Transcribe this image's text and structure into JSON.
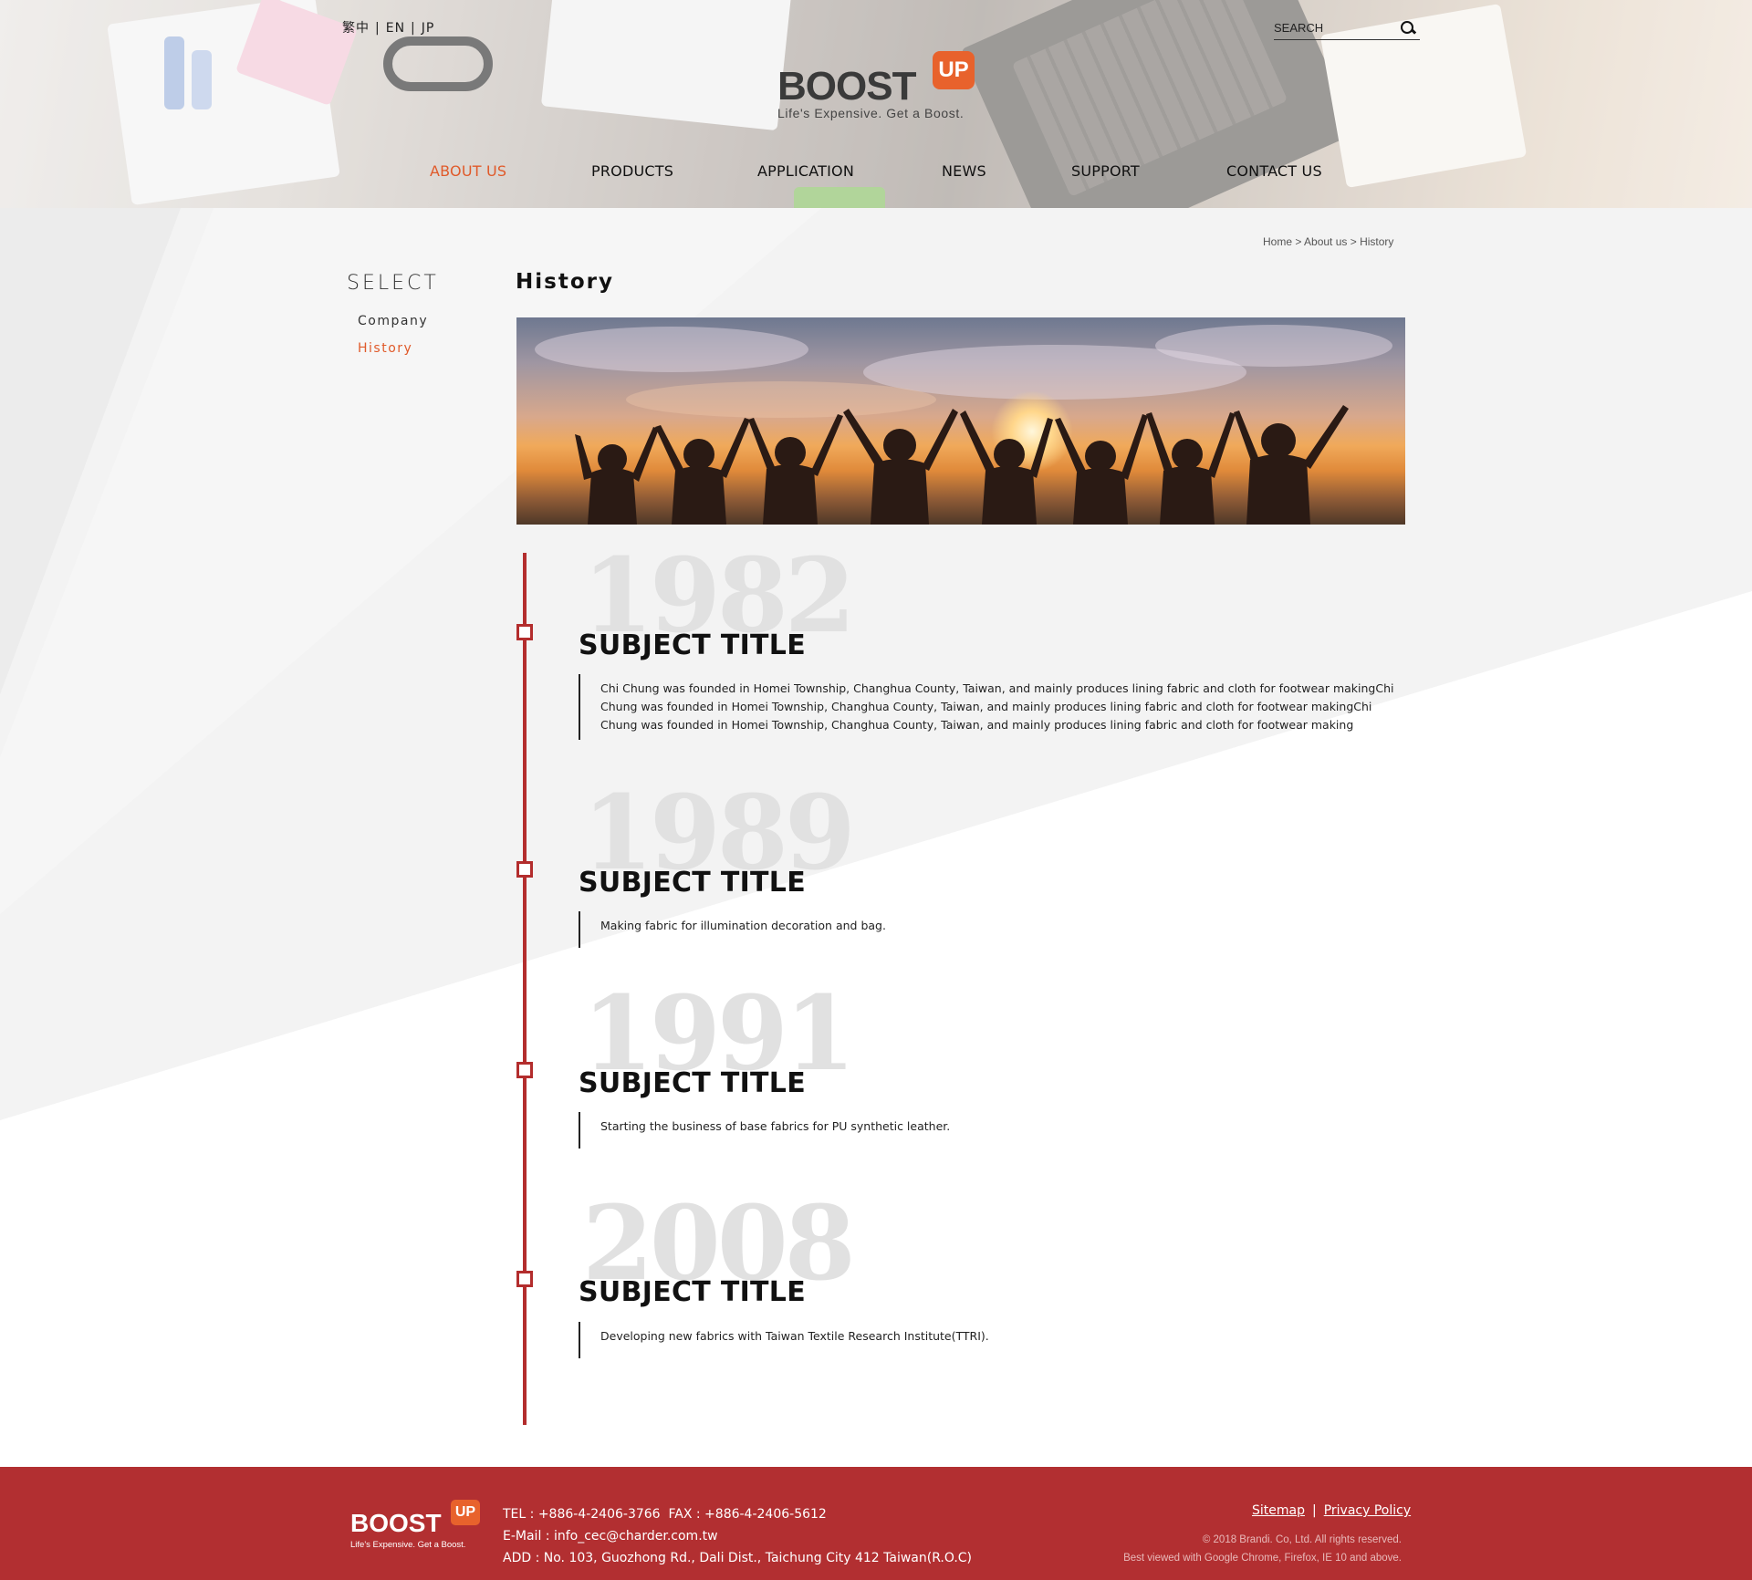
{
  "header": {
    "languages": [
      "繁中",
      "EN",
      "JP"
    ],
    "search_placeholder": "SEARCH",
    "logo": {
      "word": "BOOST",
      "badge": "UP",
      "tagline": "Life's Expensive. Get a Boost."
    },
    "nav": [
      {
        "label": "ABOUT US",
        "active": true
      },
      {
        "label": "PRODUCTS",
        "active": false
      },
      {
        "label": "APPLICATION",
        "active": false
      },
      {
        "label": "NEWS",
        "active": false
      },
      {
        "label": "SUPPORT",
        "active": false
      },
      {
        "label": "CONTACT US",
        "active": false
      }
    ],
    "accent_color": "#e05a2a"
  },
  "breadcrumb": "Home > About us > History",
  "sidebar": {
    "title": "SELECT",
    "items": [
      {
        "label": "Company",
        "active": false
      },
      {
        "label": "History",
        "active": true
      }
    ]
  },
  "main": {
    "title": "History",
    "timeline": [
      {
        "year": "1982",
        "title": "SUBJECT TITLE",
        "description": "Chi Chung was founded in Homei Township, Changhua County, Taiwan, and mainly produces lining fabric and cloth for footwear makingChi Chung was founded in Homei Township, Changhua County, Taiwan, and mainly produces lining fabric and cloth for footwear makingChi Chung was founded in Homei Township, Changhua County, Taiwan, and mainly produces lining fabric and cloth for footwear making"
      },
      {
        "year": "1989",
        "title": "SUBJECT TITLE",
        "description": "Making fabric for illumination decoration and bag."
      },
      {
        "year": "1991",
        "title": "SUBJECT TITLE",
        "description": "Starting the business of base fabrics for PU synthetic leather."
      },
      {
        "year": "2008",
        "title": "SUBJECT TITLE",
        "description": "Developing new fabrics with Taiwan Textile Research Institute(TTRI)."
      }
    ],
    "timeline_color": "#b32d2d"
  },
  "footer": {
    "logo": {
      "word": "BOOST",
      "badge": "UP",
      "tagline": "Life's Expensive. Get a Boost."
    },
    "tel": "TEL : +886-4-2406-3766",
    "fax": "FAX : +886-4-2406-5612",
    "email": "E-Mail : info_cec@charder.com.tw",
    "address": "ADD : No. 103, Guozhong Rd., Dali Dist., Taichung City 412 Taiwan(R.O.C)",
    "links": [
      "Sitemap",
      "Privacy Policy"
    ],
    "copyright": "© 2018 Brandi. Co, Ltd. All rights reserved.",
    "browser_note": "Best viewed with Google Chrome, Firefox, IE 10 and above.",
    "background_color": "#b22f31"
  }
}
